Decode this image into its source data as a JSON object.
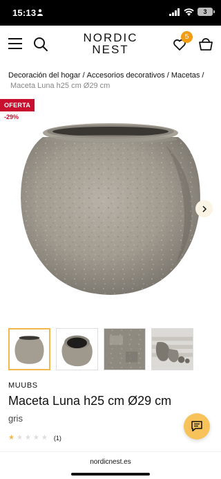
{
  "status_bar": {
    "time": "15:13",
    "battery": "3"
  },
  "header": {
    "logo_line1": "NORDIC",
    "logo_line2": "NEST",
    "wishlist_count": "5"
  },
  "breadcrumb": {
    "items": [
      "Decoración del hogar",
      "Accesorios decorativos",
      "Macetas"
    ],
    "separator": "/",
    "current": "Maceta Luna h25 cm Ø29 cm"
  },
  "badges": {
    "offer": "OFERTA",
    "discount": "-29%"
  },
  "product": {
    "brand": "MUUBS",
    "title": "Maceta Luna h25 cm Ø29 cm",
    "color": "gris",
    "rating": 1,
    "rating_max": 5,
    "review_count": "(1)"
  },
  "thumbnails": [
    {
      "name": "front-view"
    },
    {
      "name": "top-view"
    },
    {
      "name": "texture-closeup"
    },
    {
      "name": "lifestyle-stairs"
    }
  ],
  "icons": {
    "menu": "hamburger-menu-icon",
    "search": "search-icon",
    "wishlist": "heart-icon",
    "cart": "basket-icon",
    "next": "chevron-right-icon",
    "chat": "chat-icon"
  },
  "colors": {
    "accent": "#f2b84b",
    "offer_red": "#c8102e",
    "badge_orange": "#f39c12"
  },
  "browser": {
    "url": "nordicnest.es"
  }
}
